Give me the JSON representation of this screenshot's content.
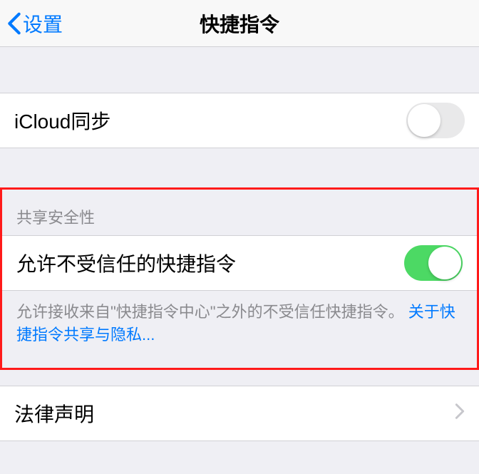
{
  "nav": {
    "back_label": "设置",
    "title": "快捷指令"
  },
  "icloud": {
    "label": "iCloud同步",
    "enabled": false
  },
  "security": {
    "header": "共享安全性",
    "allow_label": "允许不受信任的快捷指令",
    "allow_enabled": true,
    "footer_text": "允许接收来自\"快捷指令中心\"之外的不受信任快捷指令。",
    "footer_link": "关于快捷指令共享与隐私..."
  },
  "legal": {
    "label": "法律声明"
  }
}
